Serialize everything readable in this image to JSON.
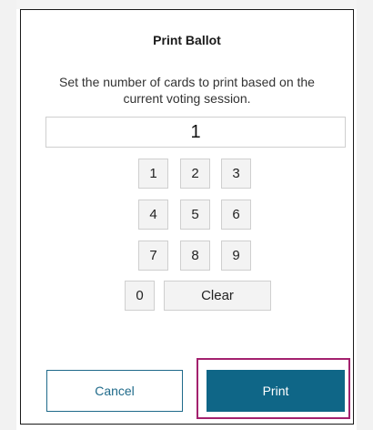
{
  "dialog": {
    "title": "Print Ballot",
    "instructions": "Set the number of cards to print based on the current voting session.",
    "display_value": "1"
  },
  "keypad": {
    "keys": [
      "1",
      "2",
      "3",
      "4",
      "5",
      "6",
      "7",
      "8",
      "9",
      "0"
    ],
    "clear_label": "Clear"
  },
  "actions": {
    "cancel_label": "Cancel",
    "print_label": "Print"
  },
  "colors": {
    "accent": "#0f6687",
    "highlight": "#a3216e"
  }
}
